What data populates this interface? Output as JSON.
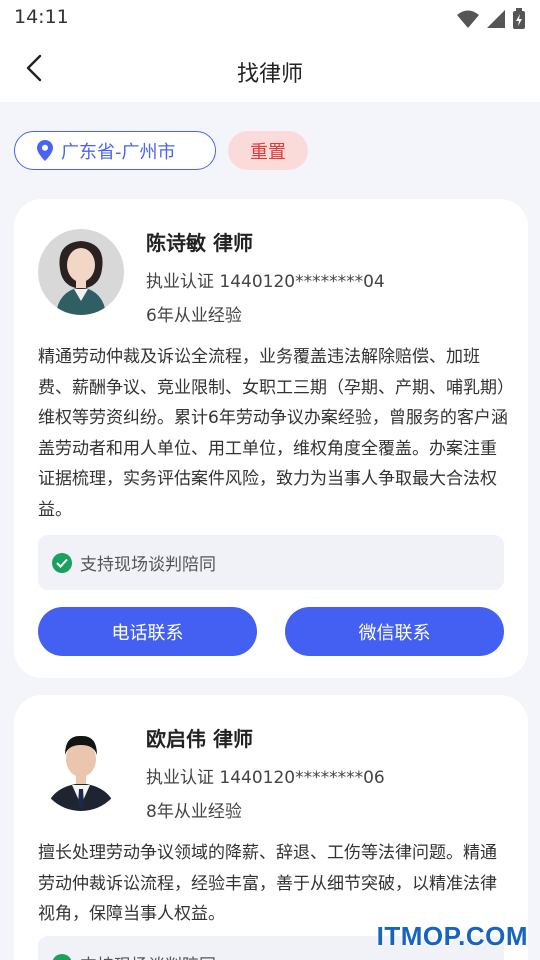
{
  "status": {
    "time": "14:11"
  },
  "nav": {
    "title": "找律师"
  },
  "filters": {
    "location": "广东省-广州市",
    "reset": "重置"
  },
  "lawyers": [
    {
      "name": "陈诗敏 律师",
      "license": "执业认证 1440120********04",
      "experience": "6年从业经验",
      "description": "精通劳动仲裁及诉讼全流程，业务覆盖违法解除赔偿、加班费、薪酬争议、竞业限制、女职工三期（孕期、产期、哺乳期）维权等劳资纠纷。累计6年劳动争议办案经验，曾服务的客户涵盖劳动者和用人单位、用工单位，维权角度全覆盖。办案注重证据梳理，实务评估案件风险，致力为当事人争取最大合法权益。",
      "support": "支持现场谈判陪同",
      "phone_button": "电话联系",
      "wechat_button": "微信联系"
    },
    {
      "name": "欧启伟 律师",
      "license": "执业认证 1440120********06",
      "experience": "8年从业经验",
      "description": "擅长处理劳动争议领域的降薪、辞退、工伤等法律问题。精通劳动仲裁诉讼流程，经验丰富，善于从细节突破，以精准法律视角，保障当事人权益。",
      "support": "支持现场谈判陪同"
    }
  ],
  "watermark": "ITMOP.COM",
  "colors": {
    "accent": "#4460f2",
    "reset_bg": "#fbdada",
    "reset_text": "#e23b3b",
    "check": "#19a15f"
  }
}
